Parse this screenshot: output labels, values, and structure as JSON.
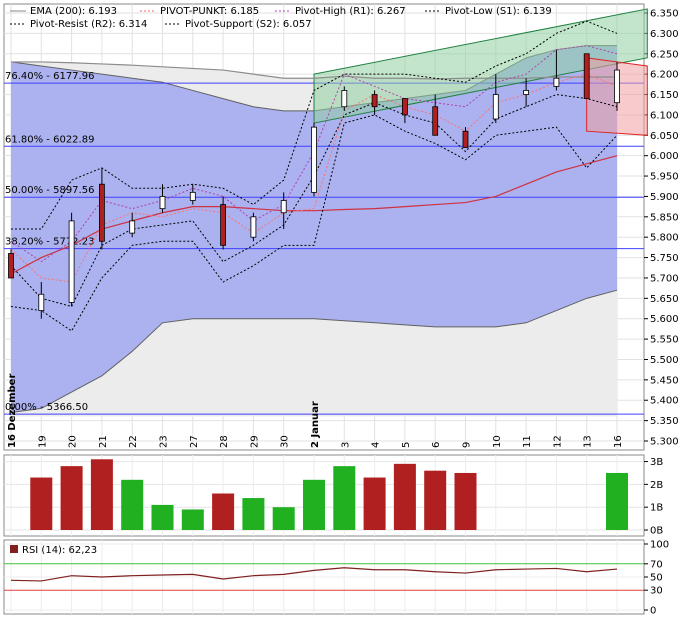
{
  "legend": [
    {
      "label": "EMA (200): 6.193",
      "color": "#888888",
      "dash": "solid"
    },
    {
      "label": "PIVOT-PUNKT: 6.185",
      "color": "#ff6060",
      "dash": "dotted"
    },
    {
      "label": "Pivot-High (R1): 6.267",
      "color": "#b040b0",
      "dash": "dotted"
    },
    {
      "label": "Pivot-Low (S1): 6.139",
      "color": "#000000",
      "dash": "dotted"
    },
    {
      "label": "Pivot-Resist (R2): 6.314",
      "color": "#000000",
      "dash": "dotted"
    },
    {
      "label": "Pivot-Support (S2): 6.057",
      "color": "#000000",
      "dash": "dotted"
    }
  ],
  "colors": {
    "up_candle": "#ffffff",
    "down_candle": "#b02020",
    "band_fill": "#a0a8f0",
    "band_line": "#606060",
    "fib_line": "#4040ff",
    "volume_up": "#20b020",
    "volume_down": "#b02020",
    "rsi_line": "#802020",
    "rsi_70": "#40c040",
    "rsi_30": "#e04040",
    "channel_green": "#90d0a0",
    "channel_red": "#f0a0a0"
  },
  "chart_data": [
    {
      "type": "candlestick",
      "x": [
        "16 Dezember",
        "19",
        "20",
        "21",
        "22",
        "23",
        "27",
        "28",
        "29",
        "30",
        "2 Januar",
        "3",
        "4",
        "5",
        "6",
        "9",
        "10",
        "11",
        "12",
        "13",
        "16"
      ],
      "x_labels_rotated": [
        "16 Dezember",
        "19",
        "20",
        "21",
        "22",
        "23",
        "27",
        "28",
        "29",
        "30",
        "2 Januar",
        "3",
        "4",
        "5",
        "6",
        "9",
        "10",
        "11",
        "12",
        "13",
        "16"
      ],
      "ylim": [
        5.3,
        6.36
      ],
      "y_ticks": [
        "6.350",
        "6.300",
        "6.250",
        "6.200",
        "6.150",
        "6.100",
        "6.050",
        "6.000",
        "5.950",
        "5.900",
        "5.850",
        "5.800",
        "5.750",
        "5.700",
        "5.650",
        "5.600",
        "5.550",
        "5.500",
        "5.450",
        "5.400",
        "5.350",
        "5.300"
      ],
      "candles": [
        {
          "o": 5.76,
          "h": 5.77,
          "l": 5.7,
          "c": 5.7
        },
        {
          "o": 5.62,
          "h": 5.69,
          "l": 5.6,
          "c": 5.66
        },
        {
          "o": 5.64,
          "h": 5.86,
          "l": 5.63,
          "c": 5.84
        },
        {
          "o": 5.93,
          "h": 5.97,
          "l": 5.77,
          "c": 5.79
        },
        {
          "o": 5.81,
          "h": 5.86,
          "l": 5.8,
          "c": 5.84
        },
        {
          "o": 5.87,
          "h": 5.93,
          "l": 5.86,
          "c": 5.9
        },
        {
          "o": 5.89,
          "h": 5.93,
          "l": 5.88,
          "c": 5.91
        },
        {
          "o": 5.88,
          "h": 5.9,
          "l": 5.77,
          "c": 5.78
        },
        {
          "o": 5.8,
          "h": 5.86,
          "l": 5.79,
          "c": 5.85
        },
        {
          "o": 5.86,
          "h": 5.91,
          "l": 5.82,
          "c": 5.89
        },
        {
          "o": 5.91,
          "h": 6.08,
          "l": 5.9,
          "c": 6.07
        },
        {
          "o": 6.12,
          "h": 6.17,
          "l": 6.11,
          "c": 6.16
        },
        {
          "o": 6.15,
          "h": 6.16,
          "l": 6.1,
          "c": 6.12
        },
        {
          "o": 6.14,
          "h": 6.14,
          "l": 6.08,
          "c": 6.1
        },
        {
          "o": 6.12,
          "h": 6.15,
          "l": 6.05,
          "c": 6.05
        },
        {
          "o": 6.06,
          "h": 6.07,
          "l": 6.02,
          "c": 6.02
        },
        {
          "o": 6.09,
          "h": 6.2,
          "l": 6.08,
          "c": 6.15
        },
        {
          "o": 6.15,
          "h": 6.19,
          "l": 6.12,
          "c": 6.16
        },
        {
          "o": 6.17,
          "h": 6.26,
          "l": 6.16,
          "c": 6.19
        },
        {
          "o": 6.25,
          "h": 6.24,
          "l": 6.14,
          "c": 6.14
        },
        {
          "o": 6.13,
          "h": 6.23,
          "l": 6.11,
          "c": 6.21
        }
      ],
      "ema200": [
        6.23,
        6.23,
        6.228,
        6.225,
        6.222,
        6.218,
        6.214,
        6.21,
        6.2,
        6.19,
        6.19,
        6.195,
        6.19,
        6.19,
        6.188,
        6.19,
        6.19,
        6.19,
        6.193,
        6.193,
        6.193
      ],
      "ema_red": [
        5.71,
        5.75,
        5.78,
        5.82,
        5.84,
        5.86,
        5.875,
        5.875,
        5.87,
        5.865,
        5.865,
        5.868,
        5.87,
        5.875,
        5.88,
        5.885,
        5.9,
        5.93,
        5.96,
        5.98,
        6.0
      ],
      "band_upper": [
        6.23,
        6.22,
        6.21,
        6.2,
        6.19,
        6.18,
        6.16,
        6.14,
        6.12,
        6.11,
        6.11,
        6.12,
        6.13,
        6.14,
        6.15,
        6.16,
        6.2,
        6.24,
        6.26,
        6.27,
        6.27
      ],
      "band_lower": [
        5.37,
        5.38,
        5.42,
        5.46,
        5.52,
        5.59,
        5.6,
        5.6,
        5.6,
        5.6,
        5.6,
        5.595,
        5.59,
        5.585,
        5.58,
        5.58,
        5.58,
        5.59,
        5.62,
        5.65,
        5.67
      ],
      "pivot": [
        5.77,
        5.7,
        5.69,
        5.83,
        5.86,
        5.85,
        5.87,
        5.86,
        5.81,
        5.86,
        5.87,
        6.11,
        6.15,
        6.12,
        6.1,
        6.06,
        6.13,
        6.15,
        6.18,
        6.2,
        6.17
      ],
      "r1": [
        5.79,
        5.74,
        5.79,
        5.89,
        5.87,
        5.89,
        5.92,
        5.9,
        5.84,
        5.88,
        6.01,
        6.2,
        6.17,
        6.14,
        6.13,
        6.12,
        6.18,
        6.2,
        6.26,
        6.27,
        6.25
      ],
      "s1": [
        5.73,
        5.65,
        5.63,
        5.78,
        5.82,
        5.83,
        5.84,
        5.74,
        5.78,
        5.83,
        5.95,
        6.1,
        6.13,
        6.1,
        6.08,
        6.01,
        6.09,
        6.12,
        6.15,
        6.14,
        6.12
      ],
      "r2": [
        5.82,
        5.82,
        5.94,
        5.97,
        5.92,
        5.92,
        5.93,
        5.92,
        5.88,
        5.94,
        6.16,
        6.2,
        6.2,
        6.2,
        6.19,
        6.18,
        6.22,
        6.25,
        6.3,
        6.33,
        6.3
      ],
      "s2": [
        5.63,
        5.62,
        5.57,
        5.7,
        5.78,
        5.79,
        5.79,
        5.69,
        5.73,
        5.78,
        5.78,
        6.08,
        6.1,
        6.06,
        6.03,
        5.99,
        6.05,
        6.06,
        6.07,
        5.97,
        6.05
      ],
      "fib_levels": [
        {
          "label": "76.40% - 6177.96",
          "value": 6.178
        },
        {
          "label": "61.80% - 6022.89",
          "value": 6.023
        },
        {
          "label": "50.00% - 5897.56",
          "value": 5.898
        },
        {
          "label": "38.20% - 5772.23",
          "value": 5.772
        },
        {
          "label": "0.00% - 5366.50",
          "value": 5.366
        }
      ],
      "channel_green": {
        "start_index": 10,
        "end_index": 21,
        "top_start": 6.2,
        "top_end": 6.36,
        "bottom_start": 6.08,
        "bottom_end": 6.24
      },
      "channel_red": {
        "start_index": 19,
        "end_index": 21,
        "top_start": 6.24,
        "top_end": 6.22,
        "bottom_start": 6.06,
        "bottom_end": 6.05
      }
    },
    {
      "type": "bar",
      "name": "Volume",
      "y_ticks": [
        "3B",
        "2B",
        "1B",
        "0B"
      ],
      "ylim": [
        0,
        3.2
      ],
      "values": [
        null,
        2.3,
        2.8,
        3.1,
        2.2,
        1.1,
        0.9,
        1.6,
        1.4,
        1.0,
        2.2,
        2.8,
        2.3,
        2.9,
        2.6,
        2.5,
        null,
        null,
        null,
        null,
        2.5
      ],
      "colors": [
        "down",
        "down",
        "down",
        "down",
        "up",
        "up",
        "up",
        "down",
        "up",
        "up",
        "up",
        "up",
        "down",
        "down",
        "down",
        "down",
        "",
        "",
        "",
        "",
        "up"
      ]
    },
    {
      "type": "line",
      "name": "RSI (14): 62,23",
      "legend_label": "RSI (14): 62,23",
      "y_ticks": [
        "100",
        "70",
        "50",
        "30",
        "0"
      ],
      "ylim": [
        0,
        100
      ],
      "levels": [
        70,
        30
      ],
      "values": [
        45,
        44,
        52,
        50,
        52,
        53,
        54,
        47,
        52,
        54,
        60,
        64,
        61,
        61,
        58,
        56,
        61,
        62,
        63,
        58,
        62
      ]
    }
  ]
}
